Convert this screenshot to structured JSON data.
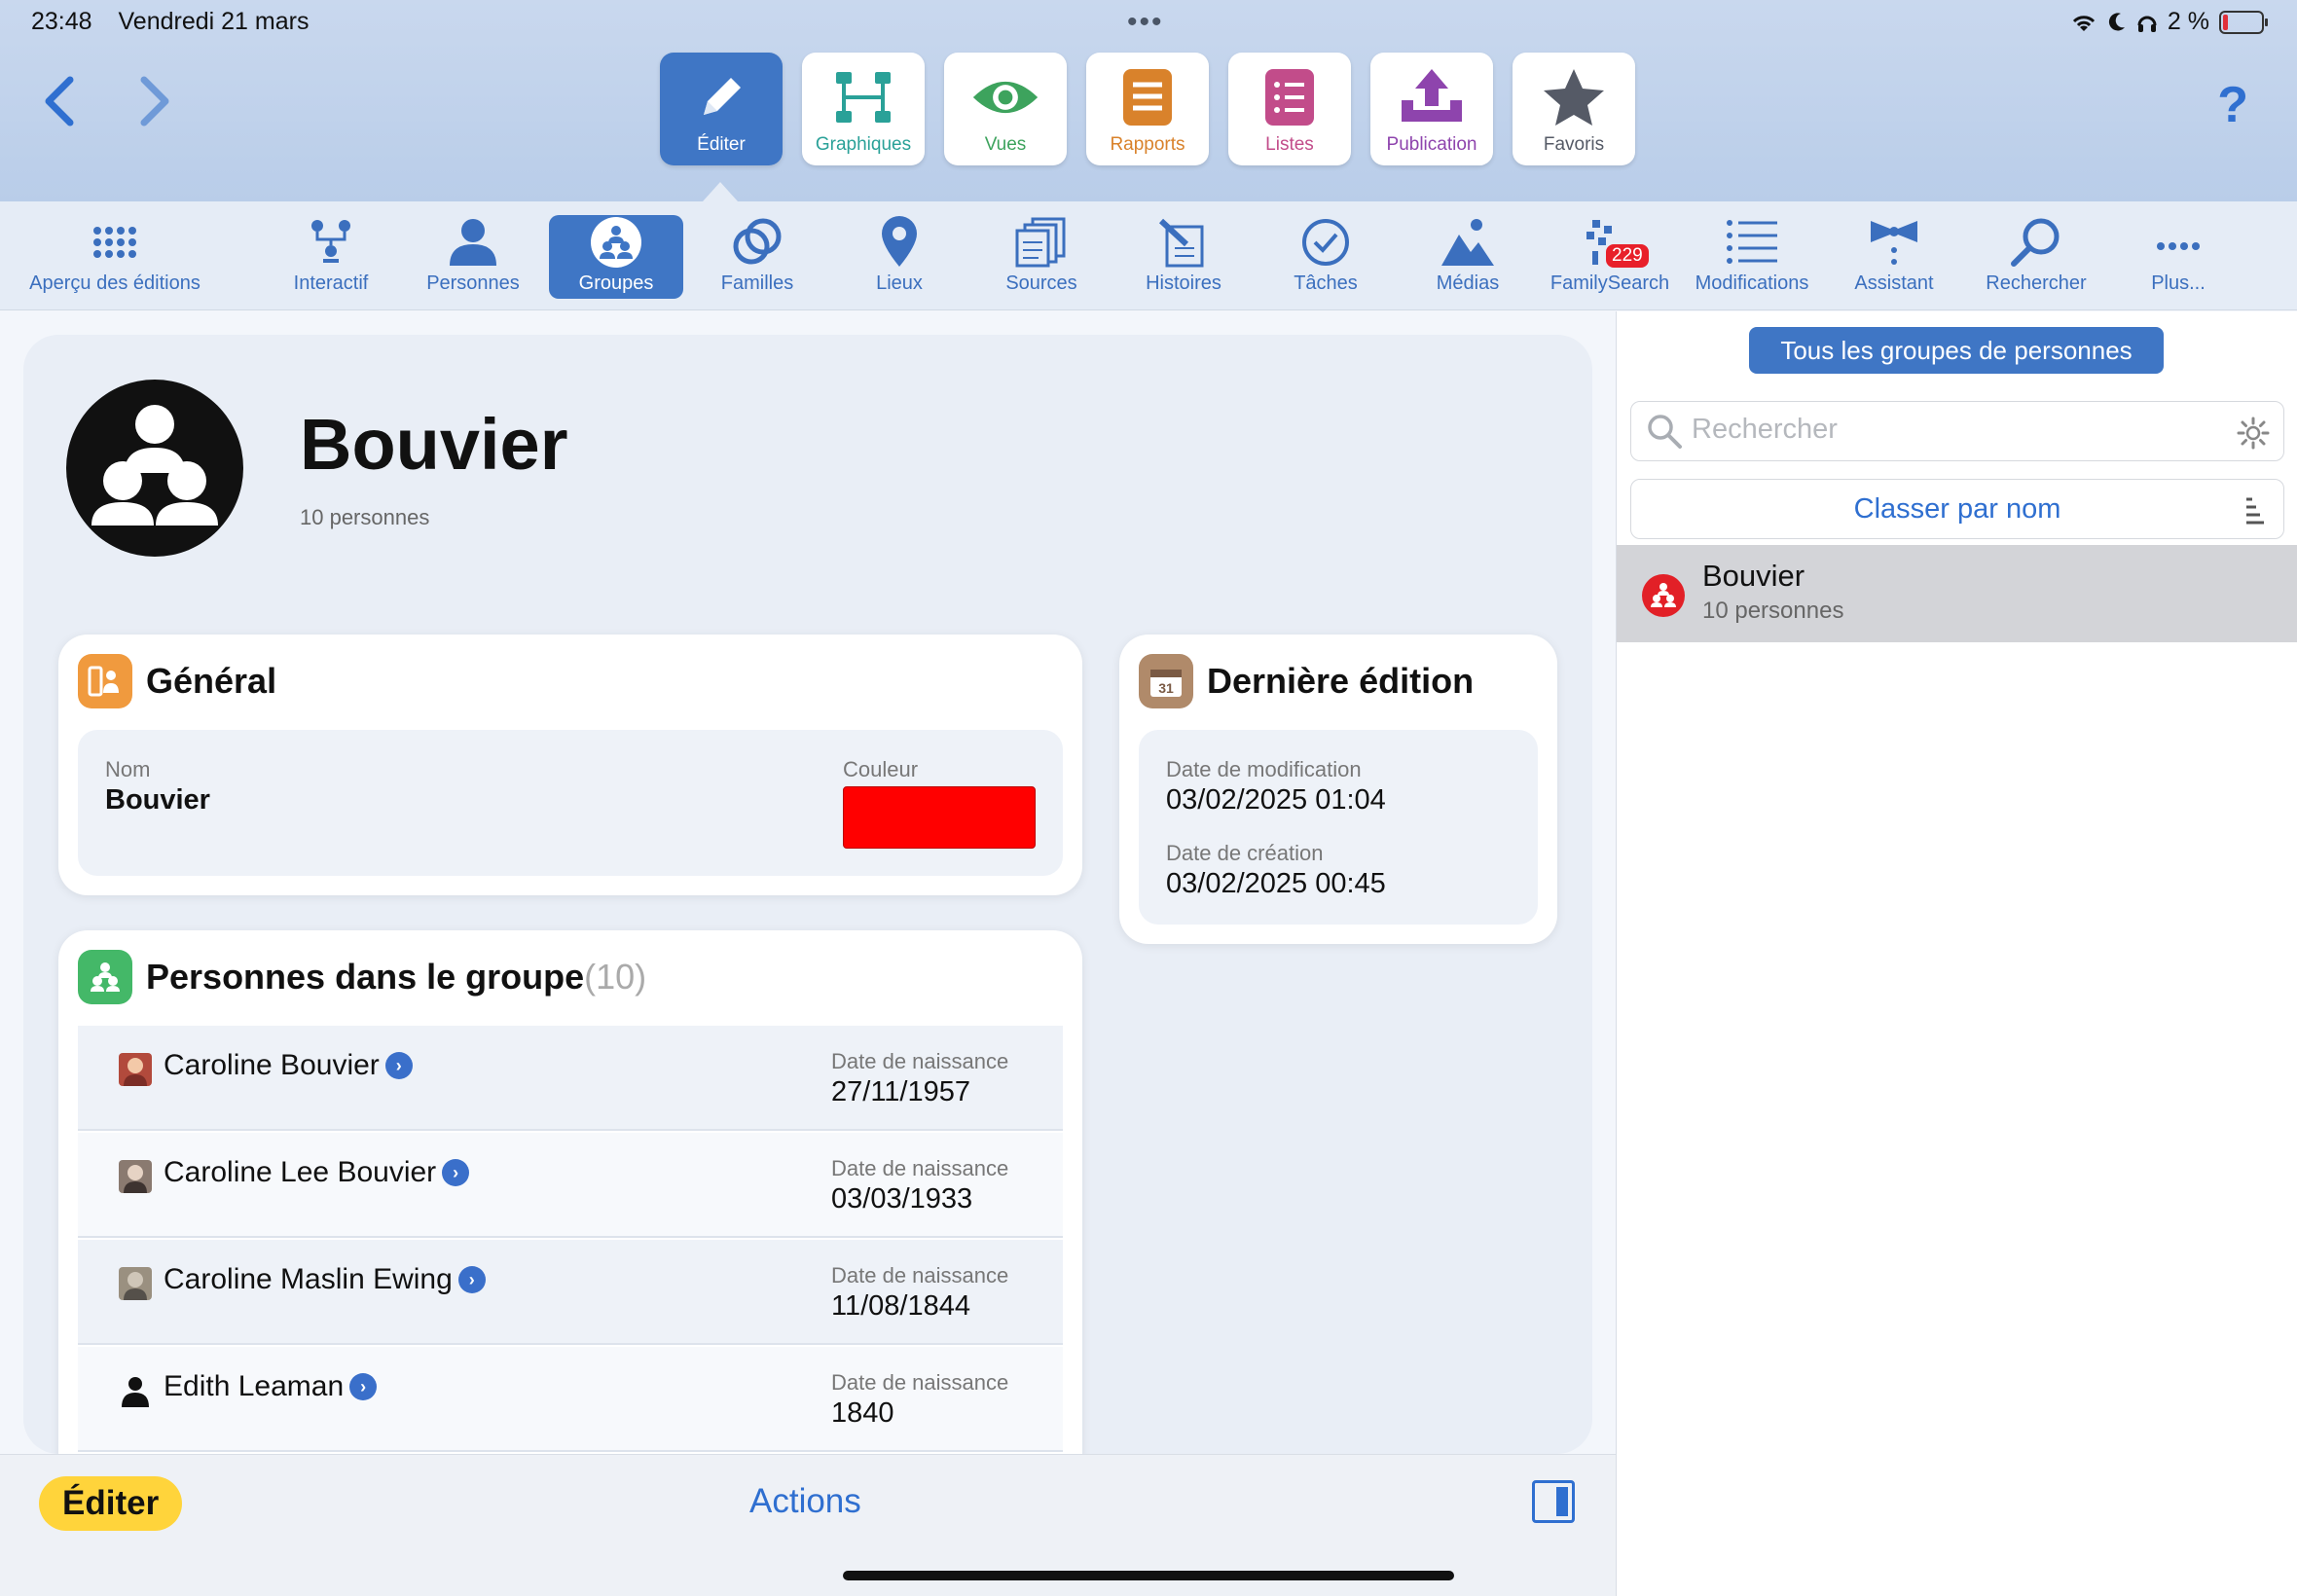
{
  "status": {
    "time": "23:48",
    "date": "Vendredi 21 mars",
    "battery": "2 %"
  },
  "main_tools": [
    {
      "label": "Éditer",
      "icon": "pencil-icon",
      "color": "#ffffff",
      "active": true
    },
    {
      "label": "Graphiques",
      "icon": "tree-chart-icon",
      "color": "#2aa198"
    },
    {
      "label": "Vues",
      "icon": "eye-icon",
      "color": "#3da35d"
    },
    {
      "label": "Rapports",
      "icon": "report-icon",
      "color": "#d9822b"
    },
    {
      "label": "Listes",
      "icon": "list-icon",
      "color": "#c24c8a"
    },
    {
      "label": "Publication",
      "icon": "upload-icon",
      "color": "#8e44ad"
    },
    {
      "label": "Favoris",
      "icon": "star-icon",
      "color": "#555a66"
    }
  ],
  "sub_tools": [
    {
      "label": "Aperçu des éditions",
      "icon": "grid-dots-icon"
    },
    {
      "label": "Interactif",
      "icon": "interactive-tree-icon"
    },
    {
      "label": "Personnes",
      "icon": "person-icon"
    },
    {
      "label": "Groupes",
      "icon": "group-icon",
      "active": true
    },
    {
      "label": "Familles",
      "icon": "rings-icon"
    },
    {
      "label": "Lieux",
      "icon": "pin-icon"
    },
    {
      "label": "Sources",
      "icon": "sources-icon"
    },
    {
      "label": "Histoires",
      "icon": "stories-icon"
    },
    {
      "label": "Tâches",
      "icon": "check-circle-icon"
    },
    {
      "label": "Médias",
      "icon": "media-icon"
    },
    {
      "label": "FamilySearch",
      "icon": "familysearch-icon",
      "badge": "229"
    },
    {
      "label": "Modifications",
      "icon": "changes-list-icon"
    },
    {
      "label": "Assistant",
      "icon": "wand-icon"
    },
    {
      "label": "Rechercher",
      "icon": "search-icon"
    },
    {
      "label": "Plus...",
      "icon": "more-dots-icon"
    }
  ],
  "group": {
    "name": "Bouvier",
    "count_text": "10 personnes"
  },
  "general": {
    "title": "Général",
    "name_label": "Nom",
    "name_value": "Bouvier",
    "color_label": "Couleur",
    "color_value": "#ff0000"
  },
  "last_edit": {
    "title": "Dernière édition",
    "modified_label": "Date de modification",
    "modified_value": "03/02/2025 01:04",
    "created_label": "Date de création",
    "created_value": "03/02/2025 00:45"
  },
  "persons": {
    "title": "Personnes dans le groupe",
    "count": "(10)",
    "birth_label": "Date de naissance",
    "items": [
      {
        "name": "Caroline Bouvier",
        "birth": "27/11/1957"
      },
      {
        "name": "Caroline Lee Bouvier",
        "birth": "03/03/1933"
      },
      {
        "name": "Caroline Maslin Ewing",
        "birth": "11/08/1844"
      },
      {
        "name": "Edith Leaman",
        "birth": "1840"
      }
    ]
  },
  "bottom": {
    "edit_label": "Éditer",
    "actions_label": "Actions"
  },
  "sidebar": {
    "all_groups_label": "Tous les groupes de personnes",
    "search_placeholder": "Rechercher",
    "sort_label": "Classer par nom",
    "groups": [
      {
        "name": "Bouvier",
        "count": "10 personnes"
      }
    ]
  }
}
